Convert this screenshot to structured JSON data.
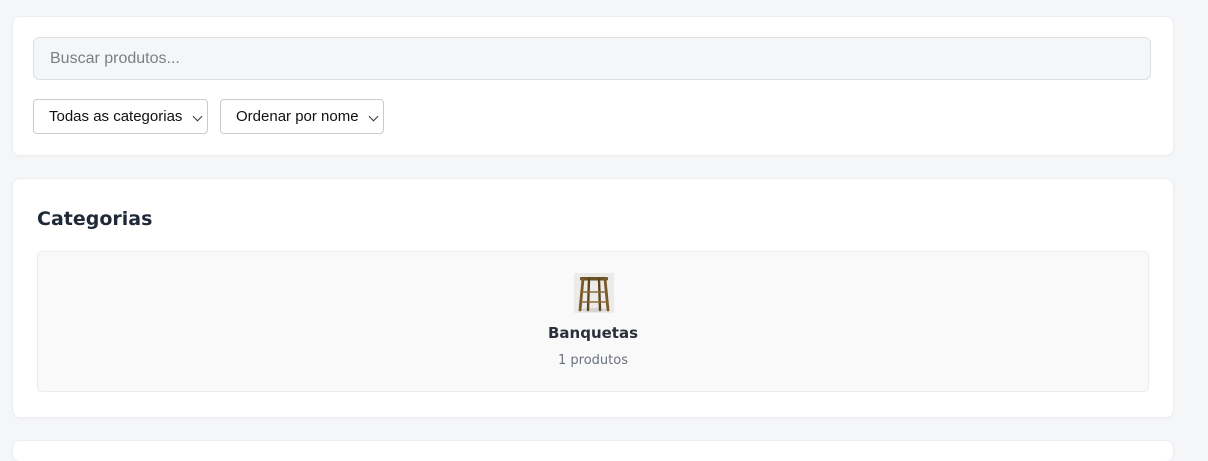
{
  "filters": {
    "search_placeholder": "Buscar produtos...",
    "category_select": "Todas as categorias",
    "sort_select": "Ordenar por nome"
  },
  "categories": {
    "title": "Categorias",
    "items": [
      {
        "name": "Banquetas",
        "count_label": "1 produtos",
        "icon": "bar-stool-image"
      }
    ]
  }
}
